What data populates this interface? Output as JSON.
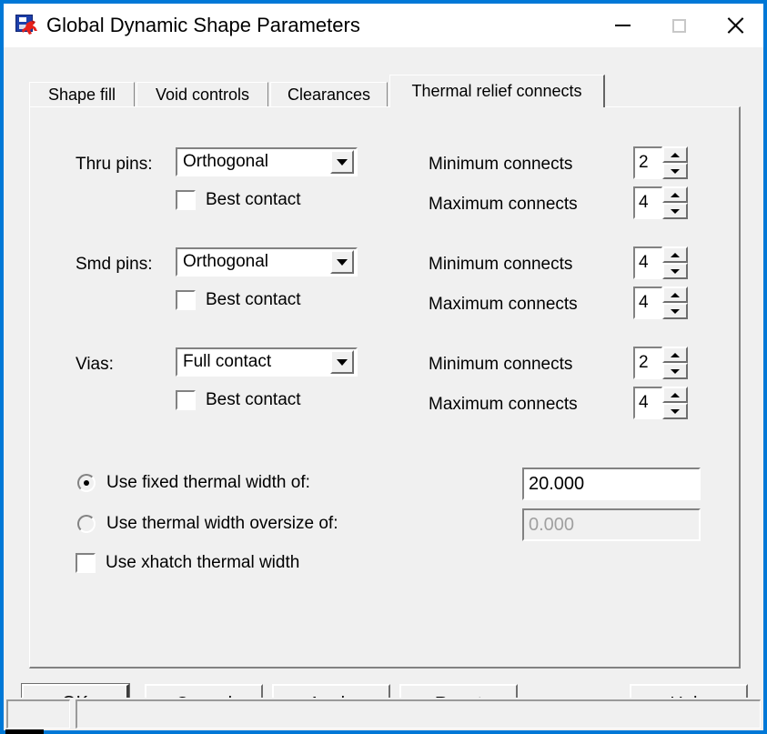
{
  "window": {
    "title": "Global Dynamic Shape Parameters",
    "icon": "pads-shape-icon",
    "border_color": "#0078d7",
    "caption_buttons": [
      {
        "name": "minimize",
        "glyph": "minimize-icon",
        "enabled": true
      },
      {
        "name": "maximize",
        "glyph": "maximize-icon",
        "enabled": false
      },
      {
        "name": "close",
        "glyph": "close-icon",
        "enabled": true
      }
    ]
  },
  "tabs": [
    {
      "label": "Shape fill",
      "active": false
    },
    {
      "label": "Void controls",
      "active": false
    },
    {
      "label": "Clearances",
      "active": false
    },
    {
      "label": "Thermal relief connects",
      "active": true
    }
  ],
  "rows": [
    {
      "label": "Thru pins:",
      "combo_value": "Orthogonal",
      "checkbox_label": "Best contact",
      "checkbox_checked": false,
      "min_label": "Minimum connects",
      "min_value": "2",
      "max_label": "Maximum connects",
      "max_value": "4"
    },
    {
      "label": "Smd pins:",
      "combo_value": "Orthogonal",
      "checkbox_label": "Best contact",
      "checkbox_checked": false,
      "min_label": "Minimum connects",
      "min_value": "4",
      "max_label": "Maximum connects",
      "max_value": "4"
    },
    {
      "label": "Vias:",
      "combo_value": "Full contact",
      "checkbox_label": "Best contact",
      "checkbox_checked": false,
      "min_label": "Minimum connects",
      "min_value": "2",
      "max_label": "Maximum connects",
      "max_value": "4"
    }
  ],
  "thermal_width": {
    "fixed_radio_label": "Use fixed thermal width of:",
    "fixed_radio_selected": true,
    "fixed_value": "20.000",
    "oversize_radio_label": "Use thermal width oversize of:",
    "oversize_radio_selected": false,
    "oversize_value": "0.000",
    "oversize_disabled": true,
    "xhatch_checkbox_label": "Use xhatch thermal width",
    "xhatch_checked": false
  },
  "buttons": {
    "ok": "OK",
    "cancel": "Cancel",
    "apply": "Apply",
    "reset": "Reset",
    "help": "Help"
  },
  "statusbar": {
    "pane1": "",
    "pane2": ""
  }
}
